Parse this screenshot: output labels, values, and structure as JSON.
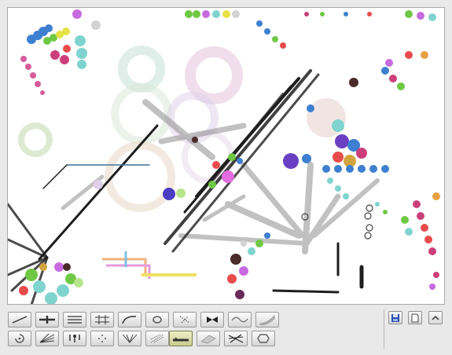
{
  "canvas": {
    "background": "#ffffff"
  },
  "tools_row1": [
    {
      "name": "line-tool-icon"
    },
    {
      "name": "double-line-tool-icon"
    },
    {
      "name": "parallel-lines-tool-icon"
    },
    {
      "name": "grid-tool-icon"
    },
    {
      "name": "curve-tool-icon"
    },
    {
      "name": "ellipse-tool-icon"
    },
    {
      "name": "scatter-tool-icon"
    },
    {
      "name": "bowtie-tool-icon"
    },
    {
      "name": "wave-tool-icon"
    },
    {
      "name": "ribbon-tool-icon"
    }
  ],
  "tools_row2": [
    {
      "name": "spiral-tool-icon"
    },
    {
      "name": "fan-lines-tool-icon"
    },
    {
      "name": "drips-tool-icon"
    },
    {
      "name": "dots-tool-icon"
    },
    {
      "name": "converge-tool-icon"
    },
    {
      "name": "spray-tool-icon"
    },
    {
      "name": "brush-tool-icon",
      "active": true
    },
    {
      "name": "smear-tool-icon"
    },
    {
      "name": "crosshatch-tool-icon"
    },
    {
      "name": "hexagon-tool-icon"
    }
  ],
  "side_buttons": [
    {
      "name": "save-icon"
    },
    {
      "name": "new-page-icon"
    },
    {
      "name": "collapse-up-icon"
    }
  ],
  "colors": {
    "active_tool": "#d8dba0",
    "save_blue": "#2a4fb0"
  }
}
